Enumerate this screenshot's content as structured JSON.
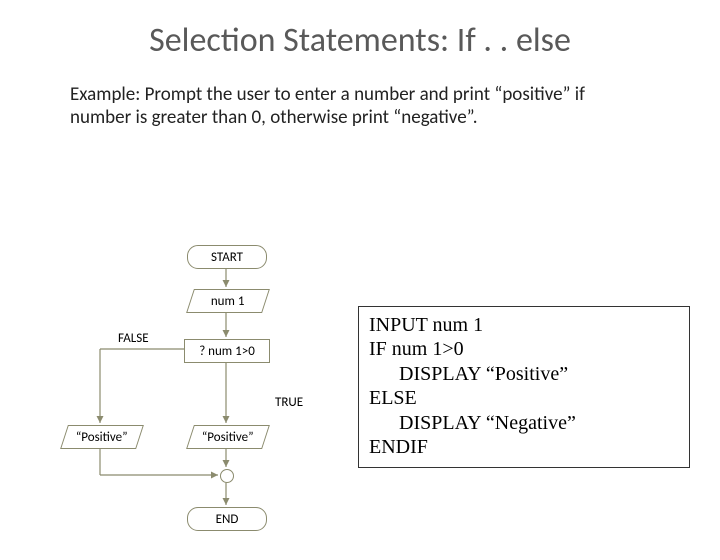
{
  "title": "Selection Statements: If . . else",
  "example": "Example: Prompt the user to enter a number and print “positive” if number is greater than 0, otherwise print “negative”.",
  "flowchart": {
    "start": "START",
    "input": "num 1",
    "decision": "? num 1>0",
    "false_label": "FALSE",
    "true_label": "TRUE",
    "left_output": "“Positive”",
    "right_output": "“Positive”",
    "end": "END"
  },
  "pseudocode": {
    "l1": "INPUT num 1",
    "l2": "IF num 1>0",
    "l3": "DISPLAY “Positive”",
    "l4": "ELSE",
    "l5": "DISPLAY “Negative”",
    "l6": "ENDIF"
  }
}
